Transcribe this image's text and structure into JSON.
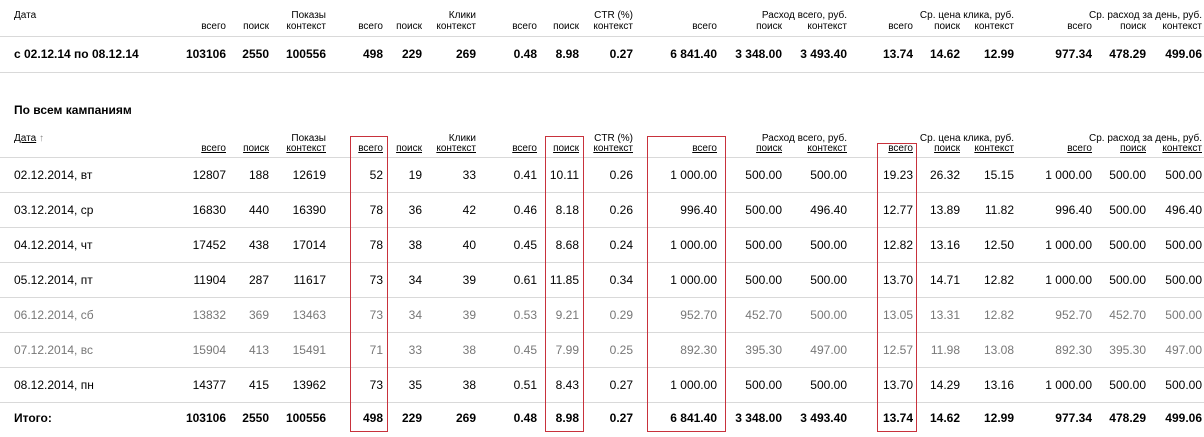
{
  "summary": {
    "date_label": "Дата",
    "headers": {
      "shows_group": "Показы",
      "clicks_group": "Клики",
      "ctr_group": "CTR (%)",
      "spend_group": "Расход всего, руб.",
      "cpc_group": "Ср. цена клика, руб.",
      "daily_group": "Ср. расход за день, руб.",
      "all": "всего",
      "search": "поиск",
      "context": "контекст"
    },
    "row": {
      "period": "с 02.12.14 по 08.12.14",
      "shows_all": "103106",
      "shows_search": "2550",
      "shows_ctx": "100556",
      "clicks_all": "498",
      "clicks_search": "229",
      "clicks_ctx": "269",
      "ctr_all": "0.48",
      "ctr_search": "8.98",
      "ctr_ctx": "0.27",
      "spend_all": "6 841.40",
      "spend_search": "3 348.00",
      "spend_ctx": "3 493.40",
      "cpc_all": "13.74",
      "cpc_search": "14.62",
      "cpc_ctx": "12.99",
      "daily_all": "977.34",
      "daily_search": "478.29",
      "daily_ctx": "499.06"
    }
  },
  "campaigns": {
    "title": "По всем кампаниям",
    "date_label": "Дата",
    "sort_arrow": "↑",
    "rows": [
      {
        "date": "02.12.2014, вт",
        "c": [
          "12807",
          "188",
          "12619",
          "52",
          "19",
          "33",
          "0.41",
          "10.11",
          "0.26",
          "1 000.00",
          "500.00",
          "500.00",
          "19.23",
          "26.32",
          "15.15",
          "1 000.00",
          "500.00",
          "500.00"
        ]
      },
      {
        "date": "03.12.2014, ср",
        "c": [
          "16830",
          "440",
          "16390",
          "78",
          "36",
          "42",
          "0.46",
          "8.18",
          "0.26",
          "996.40",
          "500.00",
          "496.40",
          "12.77",
          "13.89",
          "11.82",
          "996.40",
          "500.00",
          "496.40"
        ]
      },
      {
        "date": "04.12.2014, чт",
        "c": [
          "17452",
          "438",
          "17014",
          "78",
          "38",
          "40",
          "0.45",
          "8.68",
          "0.24",
          "1 000.00",
          "500.00",
          "500.00",
          "12.82",
          "13.16",
          "12.50",
          "1 000.00",
          "500.00",
          "500.00"
        ]
      },
      {
        "date": "05.12.2014, пт",
        "c": [
          "11904",
          "287",
          "11617",
          "73",
          "34",
          "39",
          "0.61",
          "11.85",
          "0.34",
          "1 000.00",
          "500.00",
          "500.00",
          "13.70",
          "14.71",
          "12.82",
          "1 000.00",
          "500.00",
          "500.00"
        ]
      },
      {
        "date": "06.12.2014, сб",
        "c": [
          "13832",
          "369",
          "13463",
          "73",
          "34",
          "39",
          "0.53",
          "9.21",
          "0.29",
          "952.70",
          "452.70",
          "500.00",
          "13.05",
          "13.31",
          "12.82",
          "952.70",
          "452.70",
          "500.00"
        ]
      },
      {
        "date": "07.12.2014, вс",
        "c": [
          "15904",
          "413",
          "15491",
          "71",
          "33",
          "38",
          "0.45",
          "7.99",
          "0.25",
          "892.30",
          "395.30",
          "497.00",
          "12.57",
          "11.98",
          "13.08",
          "892.30",
          "395.30",
          "497.00"
        ]
      },
      {
        "date": "08.12.2014, пн",
        "c": [
          "14377",
          "415",
          "13962",
          "73",
          "35",
          "38",
          "0.51",
          "8.43",
          "0.27",
          "1 000.00",
          "500.00",
          "500.00",
          "13.70",
          "14.29",
          "13.16",
          "1 000.00",
          "500.00",
          "500.00"
        ]
      }
    ],
    "total": {
      "label": "Итого:",
      "c": [
        "103106",
        "2550",
        "100556",
        "498",
        "229",
        "269",
        "0.48",
        "8.98",
        "0.27",
        "6 841.40",
        "3 348.00",
        "3 493.40",
        "13.74",
        "14.62",
        "12.99",
        "977.34",
        "478.29",
        "499.06"
      ]
    }
  },
  "highlight_color": "#c8323c"
}
